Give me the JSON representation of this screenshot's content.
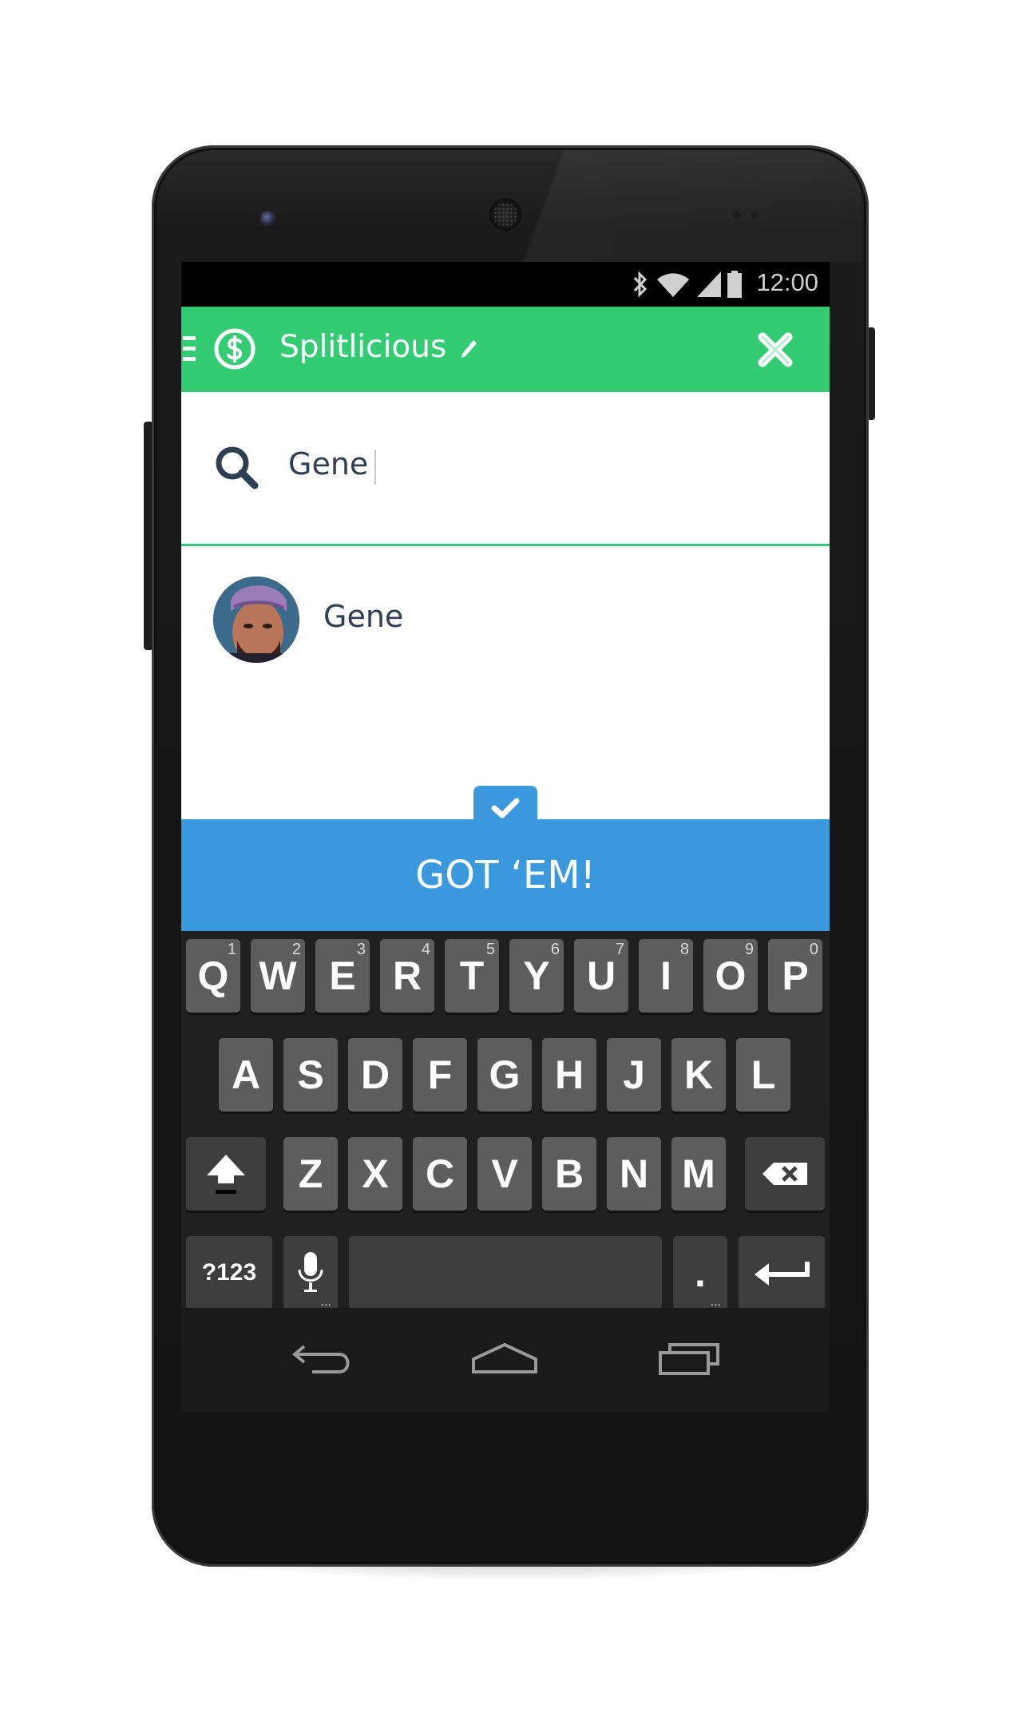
{
  "status_bar": {
    "time": "12:00",
    "icons": [
      "bluetooth-icon",
      "wifi-icon",
      "signal-icon",
      "battery-icon"
    ]
  },
  "app_bar": {
    "title": "Splitlicious",
    "icons": [
      "menu-icon",
      "dollar-logo-icon",
      "edit-pencil-icon",
      "close-icon"
    ]
  },
  "search": {
    "value": "Gene"
  },
  "results": [
    {
      "name": "Gene"
    }
  ],
  "confirm": {
    "label": "GOT ‘EM!"
  },
  "keyboard": {
    "row1": [
      {
        "k": "Q",
        "h": "1"
      },
      {
        "k": "W",
        "h": "2"
      },
      {
        "k": "E",
        "h": "3"
      },
      {
        "k": "R",
        "h": "4"
      },
      {
        "k": "T",
        "h": "5"
      },
      {
        "k": "Y",
        "h": "6"
      },
      {
        "k": "U",
        "h": "7"
      },
      {
        "k": "I",
        "h": "8"
      },
      {
        "k": "O",
        "h": "9"
      },
      {
        "k": "P",
        "h": "0"
      }
    ],
    "row2": [
      "A",
      "S",
      "D",
      "F",
      "G",
      "H",
      "J",
      "K",
      "L"
    ],
    "row3": [
      "Z",
      "X",
      "C",
      "V",
      "B",
      "N",
      "M"
    ],
    "symbols_label": "?123",
    "period_label": ".",
    "more_hint": "..."
  },
  "colors": {
    "app_bar": "#33cc74",
    "confirm": "#3a98dc",
    "text_dark": "#2f3e52"
  }
}
